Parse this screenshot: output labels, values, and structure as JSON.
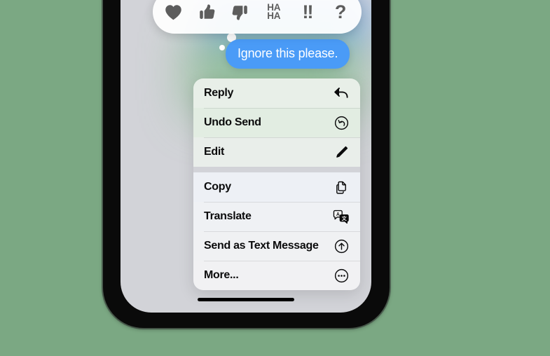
{
  "background": {
    "color": "#7ba883"
  },
  "phone": {
    "screen_bg": "#d2d3d8",
    "home_indicator": "home-indicator"
  },
  "tapbacks": {
    "name": "tapback-reaction-bar",
    "items": [
      {
        "id": "heart",
        "icon": "heart-icon",
        "label": ""
      },
      {
        "id": "thumbs-up",
        "icon": "thumbs-up-icon",
        "label": ""
      },
      {
        "id": "thumbs-down",
        "icon": "thumbs-down-icon",
        "label": ""
      },
      {
        "id": "haha",
        "icon": "haha-icon",
        "line1": "HA",
        "line2": "HA"
      },
      {
        "id": "exclamation",
        "icon": "double-exclamation-icon",
        "label": "!!"
      },
      {
        "id": "question",
        "icon": "question-mark-icon",
        "label": "?"
      }
    ]
  },
  "message": {
    "text": "Ignore this please.",
    "bubble_color": "#4a9bf7",
    "text_color": "#ffffff",
    "direction": "outgoing"
  },
  "context_menu": {
    "groups": [
      {
        "items": [
          {
            "label": "Reply",
            "icon": "reply-arrow-icon",
            "tint": "tint-a"
          },
          {
            "label": "Undo Send",
            "icon": "undo-circle-arrow-icon",
            "tint": "tint-b"
          },
          {
            "label": "Edit",
            "icon": "pencil-icon",
            "tint": "tint-c"
          }
        ]
      },
      {
        "items": [
          {
            "label": "Copy",
            "icon": "copy-documents-icon",
            "tint": "tint-d"
          },
          {
            "label": "Translate",
            "icon": "translate-bubbles-icon",
            "tint": "tint-e"
          },
          {
            "label": "Send as Text Message",
            "icon": "arrow-up-circle-icon",
            "tint": "tint-f"
          },
          {
            "label": "More...",
            "icon": "ellipsis-circle-icon",
            "tint": "tint-g"
          }
        ]
      }
    ]
  }
}
